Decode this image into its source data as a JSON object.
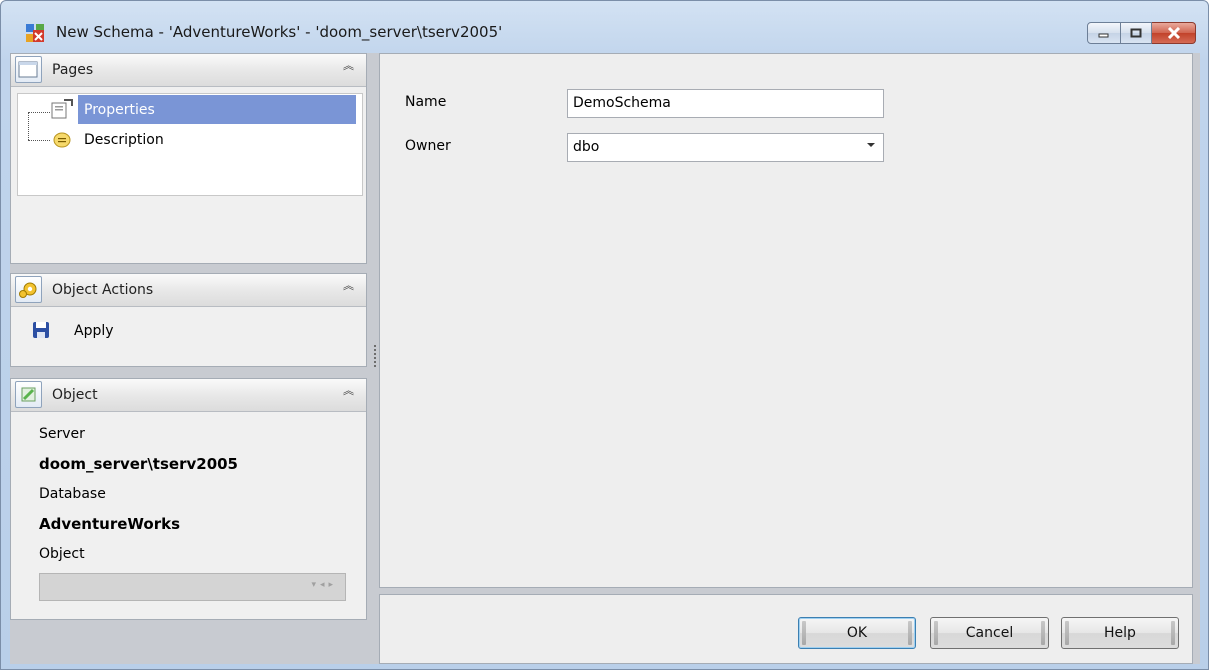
{
  "window": {
    "title": "New Schema - 'AdventureWorks' - 'doom_server\\tserv2005'"
  },
  "colors": {
    "selection": "#7a95d6",
    "close_button": "#c2422a"
  },
  "pages_panel": {
    "title": "Pages",
    "items": [
      {
        "label": "Properties",
        "icon": "properties-icon",
        "selected": true
      },
      {
        "label": "Description",
        "icon": "description-icon",
        "selected": false
      }
    ]
  },
  "actions_panel": {
    "title": "Object Actions",
    "items": [
      {
        "label": "Apply",
        "icon": "save-icon"
      }
    ]
  },
  "object_panel": {
    "title": "Object",
    "server_label": "Server",
    "server_value": "doom_server\\tserv2005",
    "database_label": "Database",
    "database_value": "AdventureWorks",
    "object_label": "Object",
    "object_value": ""
  },
  "form": {
    "name_label": "Name",
    "name_value": "DemoSchema",
    "owner_label": "Owner",
    "owner_value": "dbo"
  },
  "buttons": {
    "ok": "OK",
    "cancel": "Cancel",
    "help": "Help"
  }
}
